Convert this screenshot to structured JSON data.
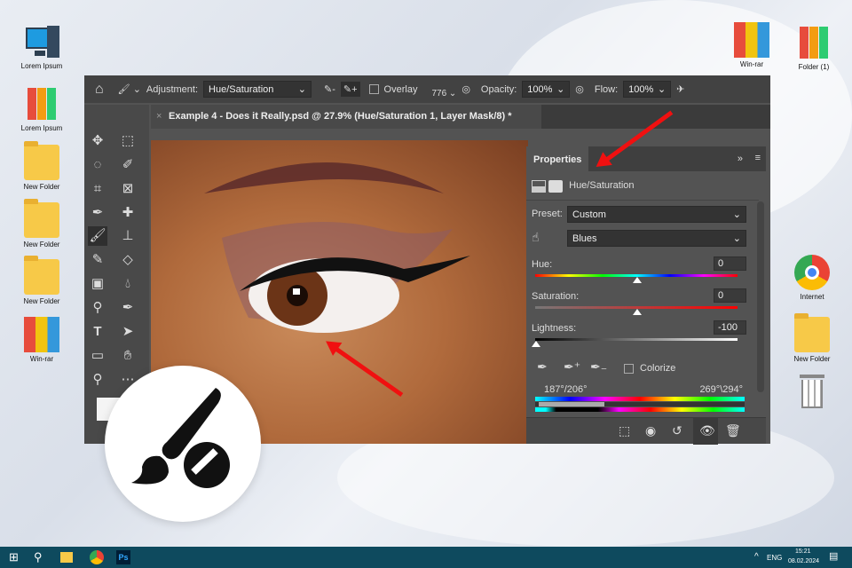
{
  "desktop": {
    "left_icons": [
      {
        "label": "Lorem Ipsum",
        "icon": "computer-icon"
      },
      {
        "label": "Lorem Ipsum",
        "icon": "binders-icon"
      },
      {
        "label": "New Folder",
        "icon": "folder-icon"
      },
      {
        "label": "New Folder",
        "icon": "folder-icon"
      },
      {
        "label": "New Folder",
        "icon": "folder-icon"
      },
      {
        "label": "Win-rar",
        "icon": "winrar-icon"
      }
    ],
    "right_icons": [
      {
        "label": "Win-rar",
        "icon": "winrar-icon"
      },
      {
        "label": "Folder (1)",
        "icon": "binders-icon"
      },
      {
        "label": "Internet",
        "icon": "chrome-icon"
      },
      {
        "label": "New Folder",
        "icon": "folder-icon"
      },
      {
        "label": "",
        "icon": "trash-icon"
      }
    ]
  },
  "photoshop": {
    "options": {
      "adjustment_label": "Adjustment:",
      "adjustment_value": "Hue/Saturation",
      "overlay_label": "Overlay",
      "brush_size": "776",
      "opacity_label": "Opacity:",
      "opacity_value": "100%",
      "flow_label": "Flow:",
      "flow_value": "100%"
    },
    "document_tab": "Example 4 - Does it Really.psd @ 27.9% (Hue/Saturation 1, Layer Mask/8) *",
    "properties": {
      "title": "Properties",
      "layer_type": "Hue/Saturation",
      "preset_label": "Preset:",
      "preset_value": "Custom",
      "channel_value": "Blues",
      "hue_label": "Hue:",
      "hue_value": "0",
      "saturation_label": "Saturation:",
      "saturation_value": "0",
      "lightness_label": "Lightness:",
      "lightness_value": "-100",
      "colorize_label": "Colorize",
      "range_left": "187°/206°",
      "range_right": "269°\\294°"
    }
  },
  "taskbar": {
    "language": "ENG",
    "time": "15:21",
    "date": "08.02.2024",
    "ps_label": "Ps"
  },
  "colors": {
    "taskbar": "#0e4a5e",
    "accent_arrow": "#f01010"
  }
}
